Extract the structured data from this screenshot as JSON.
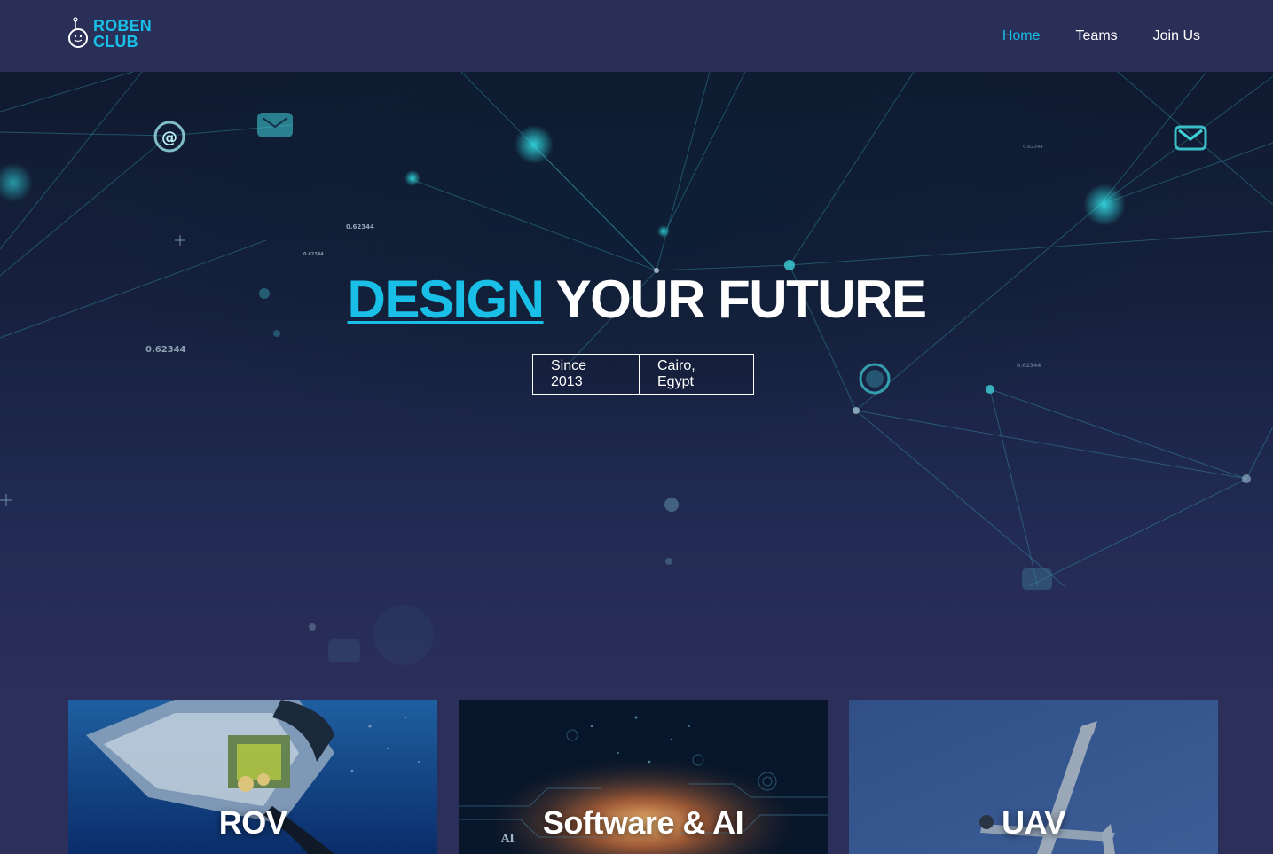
{
  "header": {
    "logo_line1": "ROBEN",
    "logo_line2": "CLUB",
    "nav": [
      {
        "label": "Home",
        "active": true
      },
      {
        "label": "Teams",
        "active": false
      },
      {
        "label": "Join Us",
        "active": false
      }
    ]
  },
  "hero": {
    "title_accent": "DESIGN",
    "title_rest": "YOUR FUTURE",
    "tags": [
      "Since 2013",
      "Cairo, Egypt"
    ],
    "floating_numbers": [
      "0.62344",
      "0.62344",
      "0.62344",
      "0.62344",
      "0.62344"
    ]
  },
  "cards": [
    {
      "label": "ROV"
    },
    {
      "label": "Software & AI",
      "image_text": "AI"
    },
    {
      "label": "UAV"
    }
  ],
  "colors": {
    "accent": "#19bfe6",
    "navbar": "#2a2f58",
    "page": "#2b2f5a"
  }
}
